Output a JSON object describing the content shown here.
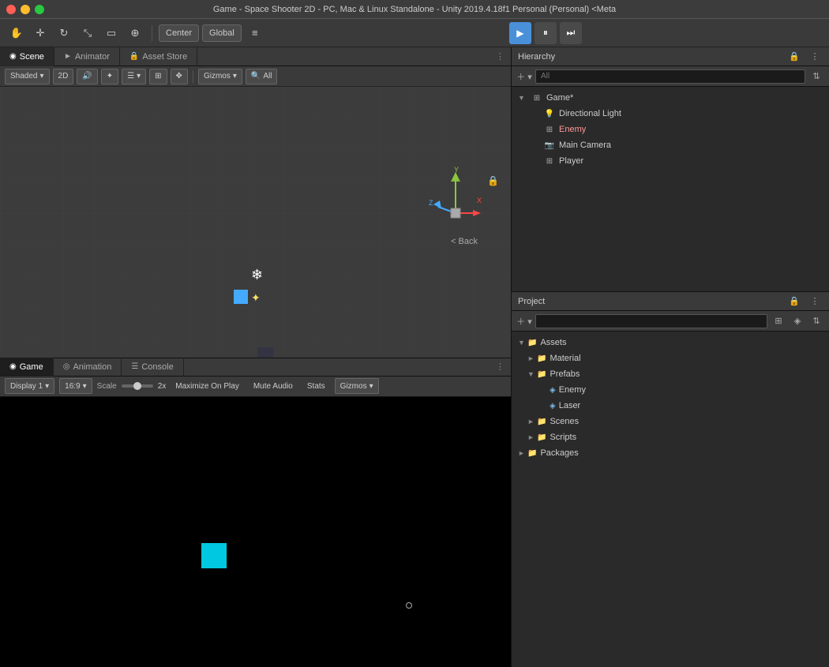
{
  "titlebar": {
    "text": "Game - Space Shooter 2D - PC, Mac & Linux Standalone - Unity 2019.4.18f1 Personal (Personal) <Meta"
  },
  "toolbar": {
    "tools": [
      "hand",
      "move",
      "rotate",
      "scale",
      "rect",
      "transform"
    ],
    "center_label": "Center",
    "global_label": "Global",
    "layers_icon": "≡",
    "play_btn": "▶",
    "pause_btn": "⏸",
    "step_btn": "⏭"
  },
  "scene": {
    "tabs": [
      {
        "label": "Scene",
        "icon": "◉",
        "active": false
      },
      {
        "label": "Animator",
        "icon": "►",
        "active": false
      },
      {
        "label": "Asset Store",
        "icon": "🔒",
        "active": false
      }
    ],
    "toolbar": {
      "shading": "Shaded",
      "mode_2d": "2D",
      "gizmos": "Gizmos",
      "all": "All"
    },
    "back_label": "< Back"
  },
  "game": {
    "tabs": [
      {
        "label": "Game",
        "icon": "◉",
        "active": true
      },
      {
        "label": "Animation",
        "icon": "◎",
        "active": false
      },
      {
        "label": "Console",
        "icon": "☰",
        "active": false
      }
    ],
    "toolbar": {
      "display": "Display 1",
      "aspect": "16:9",
      "scale_label": "Scale",
      "scale_value": "2x",
      "maximize_on_play": "Maximize On Play",
      "mute_audio": "Mute Audio",
      "stats": "Stats",
      "gizmos": "Gizmos"
    }
  },
  "hierarchy": {
    "title": "Hierarchy",
    "search_placeholder": "All",
    "items": [
      {
        "label": "Game*",
        "depth": 0,
        "arrow": "▼",
        "icon": "⊞",
        "selected": false
      },
      {
        "label": "Directional Light",
        "depth": 1,
        "arrow": "",
        "icon": "💡",
        "selected": false
      },
      {
        "label": "Enemy",
        "depth": 1,
        "arrow": "",
        "icon": "⊞",
        "selected": false,
        "highlighted": true
      },
      {
        "label": "Main Camera",
        "depth": 1,
        "arrow": "",
        "icon": "📷",
        "selected": false
      },
      {
        "label": "Player",
        "depth": 1,
        "arrow": "",
        "icon": "⊞",
        "selected": false
      }
    ]
  },
  "project": {
    "title": "Project",
    "search_placeholder": "",
    "items": [
      {
        "label": "Assets",
        "depth": 0,
        "arrow": "▼",
        "type": "folder",
        "expanded": true
      },
      {
        "label": "Material",
        "depth": 1,
        "arrow": "►",
        "type": "folder"
      },
      {
        "label": "Prefabs",
        "depth": 1,
        "arrow": "▼",
        "type": "folder",
        "expanded": true
      },
      {
        "label": "Enemy",
        "depth": 2,
        "arrow": "",
        "type": "file"
      },
      {
        "label": "Laser",
        "depth": 2,
        "arrow": "",
        "type": "file"
      },
      {
        "label": "Scenes",
        "depth": 1,
        "arrow": "►",
        "type": "folder"
      },
      {
        "label": "Scripts",
        "depth": 1,
        "arrow": "►",
        "type": "folder"
      },
      {
        "label": "Packages",
        "depth": 0,
        "arrow": "►",
        "type": "folder"
      }
    ]
  }
}
